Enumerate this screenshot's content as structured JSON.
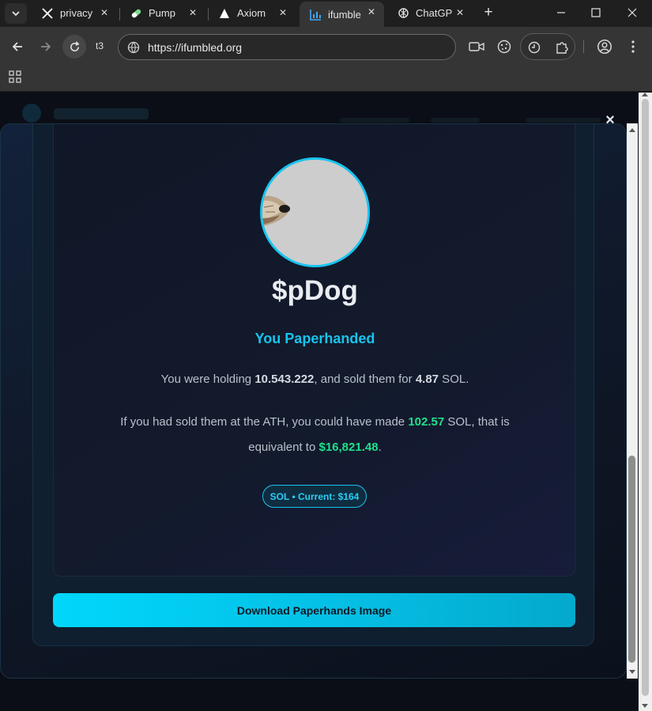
{
  "browser": {
    "tabs": [
      {
        "title": "privacy",
        "icon": "x-logo-icon",
        "active": false
      },
      {
        "title": "Pump",
        "icon": "pill-icon",
        "active": false
      },
      {
        "title": "Axiom",
        "icon": "axiom-triangle-icon",
        "active": false
      },
      {
        "title": "ifumbled",
        "icon": "bar-chart-icon",
        "active": true
      },
      {
        "title": "ChatGPT",
        "icon": "openai-icon",
        "active": false
      }
    ],
    "toolbar_label": "t3",
    "url": "https://ifumbled.org"
  },
  "modal": {
    "close_symbol": "×",
    "token_name": "$pDog",
    "status": "You Paperhanded",
    "holding_prefix": "You were holding ",
    "holding_amount": "10.543.222",
    "holding_middle": ", and sold them for ",
    "sold_for": "4.87",
    "holding_suffix": " SOL.",
    "ath_prefix": "If you had sold them at the ATH, you could have made ",
    "ath_amount": "102.57",
    "ath_middle": " SOL, that is equivalent to ",
    "ath_usd": "$16,821.48",
    "ath_suffix": ".",
    "sol_price_badge": "SOL • Current: $164",
    "download_label": "Download Paperhands Image"
  },
  "colors": {
    "accent": "#19c3ec",
    "positive": "#1fe08a",
    "card_background": "#111828"
  }
}
